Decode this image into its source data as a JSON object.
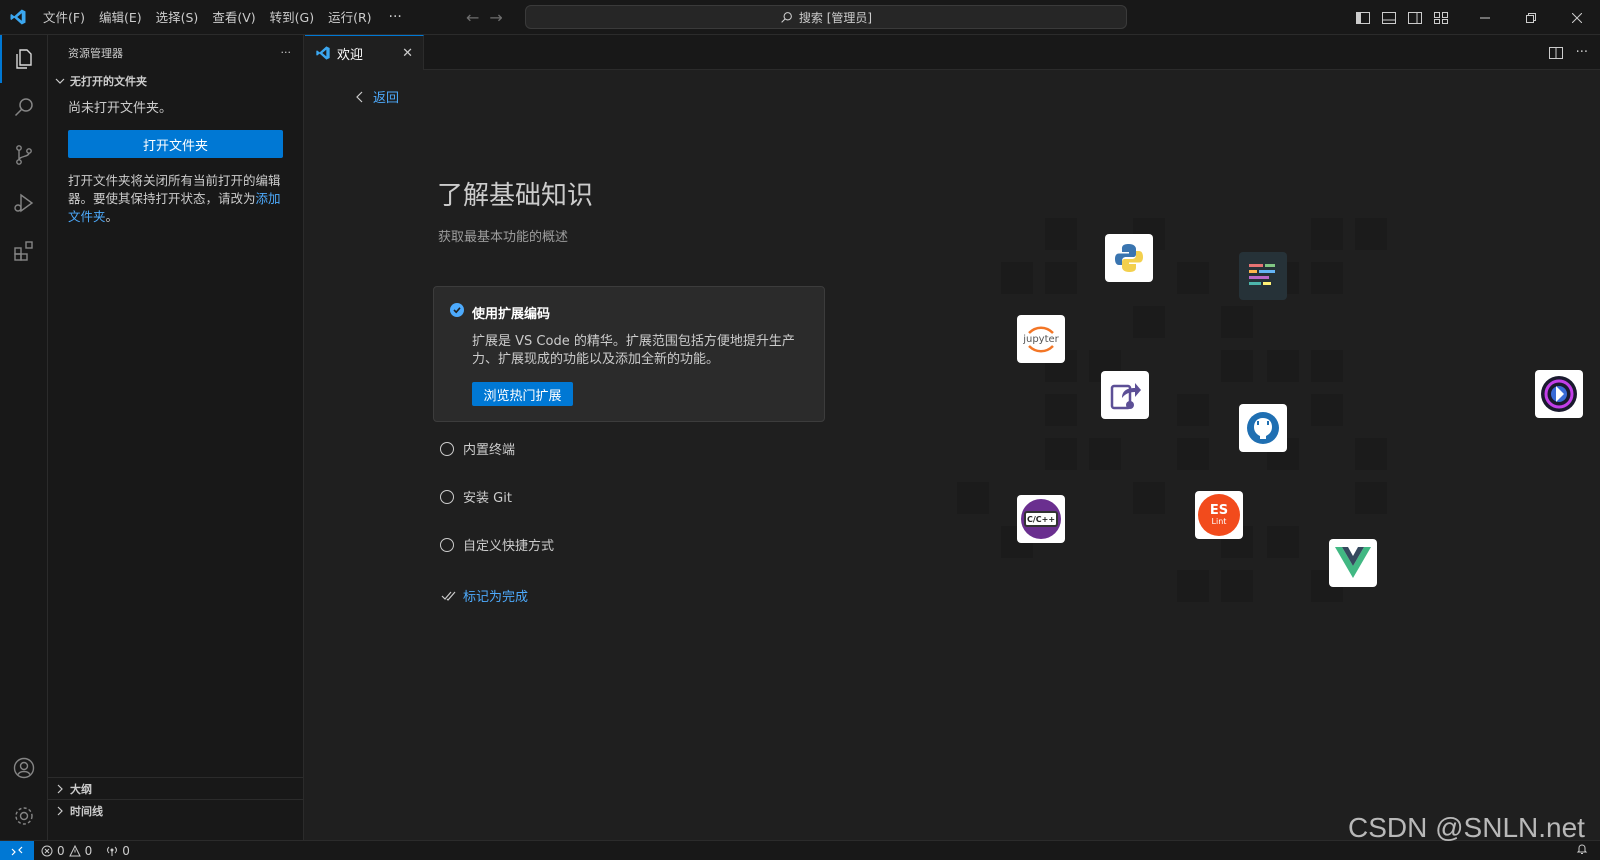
{
  "titlebar": {
    "menus": [
      "文件(F)",
      "编辑(E)",
      "选择(S)",
      "查看(V)",
      "转到(G)",
      "运行(R)"
    ],
    "more": "···",
    "search_label": "搜索 [管理员]"
  },
  "sidebar": {
    "title": "资源管理器",
    "more": "···",
    "section": "无打开的文件夹",
    "no_folder_text": "尚未打开文件夹。",
    "open_folder_button": "打开文件夹",
    "hint_text": "打开文件夹将关闭所有当前打开的编辑器。要使其保持打开状态，请改为",
    "hint_link": "添加文件夹",
    "hint_end": "。",
    "outline": "大纲",
    "timeline": "时间线"
  },
  "editor": {
    "tab_label": "欢迎",
    "back": "返回",
    "walkthrough_title": "了解基础知识",
    "walkthrough_subtitle": "获取最基本功能的概述",
    "active_step": {
      "title": "使用扩展编码",
      "description": "扩展是 VS Code 的精华。扩展范围包括方便地提升生产力、扩展现成的功能以及添加全新的功能。",
      "button": "浏览热门扩展"
    },
    "steps": [
      "内置终端",
      "安装 Git",
      "自定义快捷方式"
    ],
    "mark_done": "标记为完成"
  },
  "illustration": {
    "icons": [
      "python-icon",
      "jupyter-icon",
      "live-share-icon",
      "github-icon",
      "cpp-icon",
      "eslint-icon",
      "vue-icon",
      "copilot-icon",
      "rainbow-code-icon"
    ],
    "cpp_label": "C/C++",
    "jupyter_label": "jupyter",
    "eslint_label": "ES",
    "eslint_sub": "Lint"
  },
  "statusbar": {
    "errors": "0",
    "warnings": "0",
    "ports": "0"
  },
  "watermark": "CSDN @SNLN.net",
  "colors": {
    "accent": "#0078d4",
    "link": "#4daafc"
  }
}
